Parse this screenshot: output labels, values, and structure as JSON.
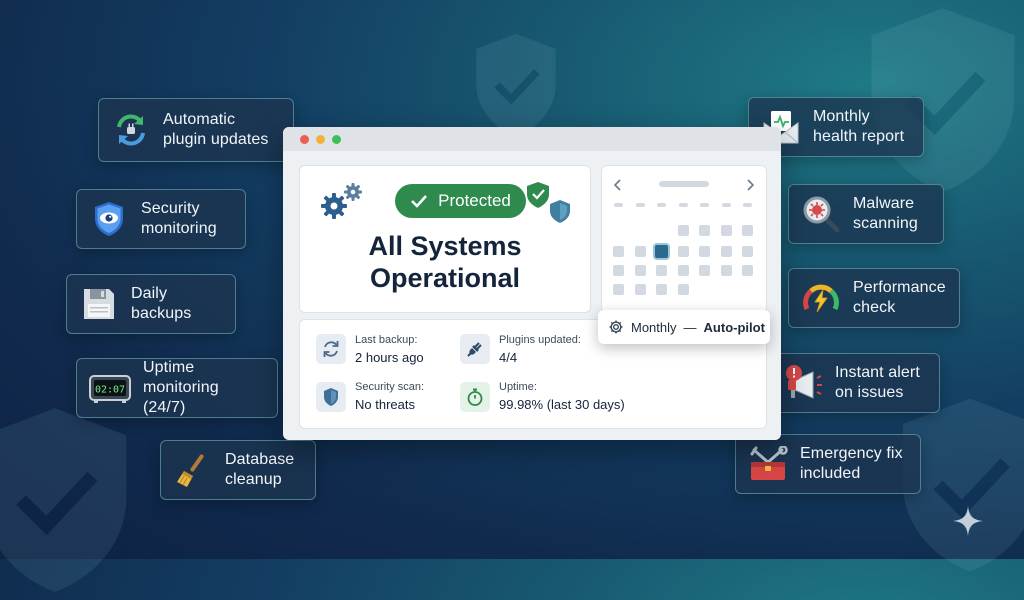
{
  "window": {
    "badge": "Protected",
    "headline_line1": "All Systems",
    "headline_line2": "Operational",
    "schedule_label": "Monthly",
    "schedule_separator": "—",
    "schedule_mode": "Auto-pilot",
    "stats": [
      {
        "label": "Last backup:",
        "value": "2 hours ago",
        "icon": "refresh-icon"
      },
      {
        "label": "Plugins updated:",
        "value": "4/4",
        "icon": "plug-icon"
      },
      {
        "label": "Security scan:",
        "value": "No threats",
        "icon": "shield-icon"
      },
      {
        "label": "Uptime:",
        "value": "99.98% (last 30 days)",
        "icon": "stopwatch-icon"
      }
    ]
  },
  "features_left": [
    {
      "label": "Automatic\nplugin updates",
      "icon": "sync-plug-icon"
    },
    {
      "label": "Security\nmonitoring",
      "icon": "eye-shield-icon"
    },
    {
      "label": "Daily\nbackups",
      "icon": "floppy-disk-icon"
    },
    {
      "label": "Uptime\nmonitoring (24/7)",
      "icon": "digital-clock-icon"
    },
    {
      "label": "Database\ncleanup",
      "icon": "broom-icon"
    }
  ],
  "features_right": [
    {
      "label": "Monthly\nhealth report",
      "icon": "envelope-report-icon"
    },
    {
      "label": "Malware\nscanning",
      "icon": "magnifier-virus-icon"
    },
    {
      "label": "Performance\ncheck",
      "icon": "speed-gauge-icon"
    },
    {
      "label": "Instant alert\non issues",
      "icon": "megaphone-alert-icon"
    },
    {
      "label": "Emergency fix\nincluded",
      "icon": "toolbox-icon"
    }
  ],
  "colors": {
    "accent_green": "#2f8a4e",
    "card_border": "#78bec8",
    "selected_day": "#2b6a8c",
    "headline": "#14243a"
  }
}
